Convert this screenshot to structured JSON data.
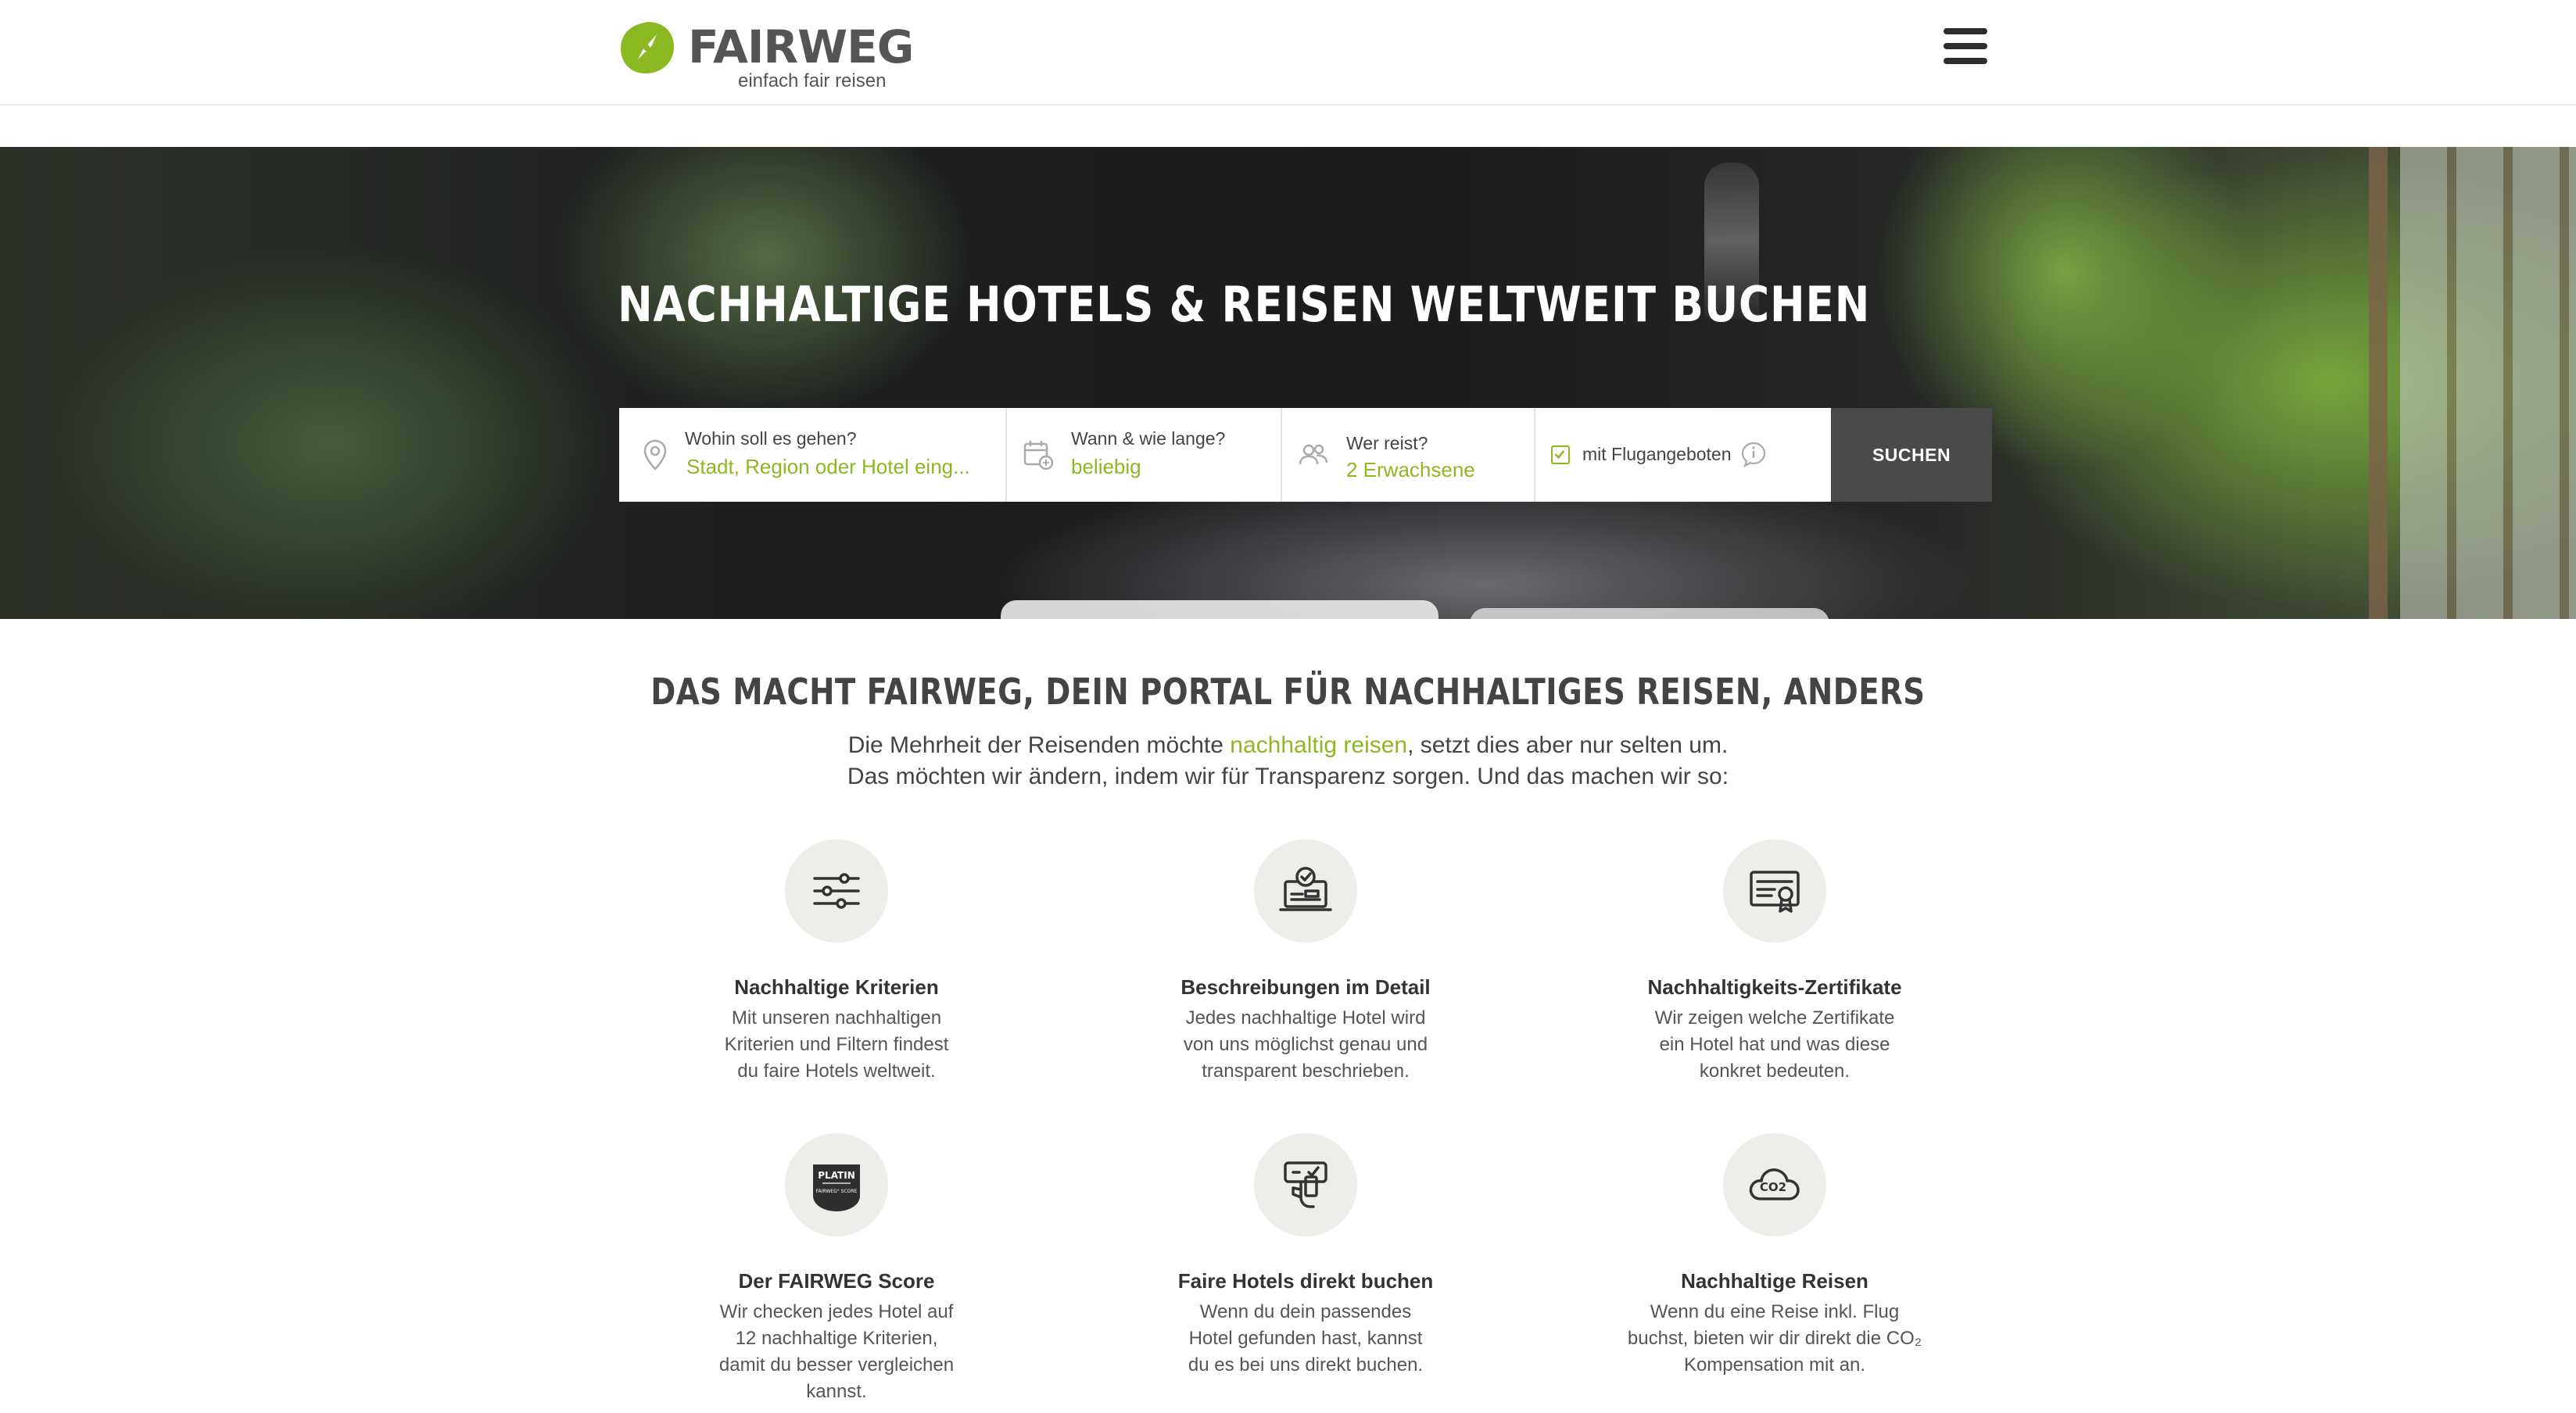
{
  "header": {
    "logo_name": "FAIRWEG",
    "logo_tagline": "einfach fair reisen",
    "menu_icon": "hamburger-menu-icon"
  },
  "hero": {
    "title": "NACHHALTIGE HOTELS & REISEN WELTWEIT BUCHEN"
  },
  "search": {
    "destination": {
      "label": "Wohin soll es gehen?",
      "placeholder": "Stadt, Region oder Hotel eing...",
      "icon": "location-pin-icon"
    },
    "dates": {
      "label": "Wann & wie lange?",
      "value": "beliebig",
      "icon": "calendar-icon"
    },
    "travelers": {
      "label": "Wer reist?",
      "value": "2 Erwachsene",
      "icon": "people-icon"
    },
    "flight": {
      "label": "mit Flugangeboten",
      "checked": true,
      "icon": "info-icon"
    },
    "button": "SUCHEN"
  },
  "section": {
    "title": "DAS MACHT FAIRWEG, DEIN PORTAL FÜR NACHHALTIGES REISEN, ANDERS",
    "intro_pre": "Die Mehrheit der Reisenden möchte ",
    "intro_link": "nachhaltig reisen",
    "intro_post": ", setzt dies aber nur selten um.",
    "intro_line2": "Das möchten wir ändern, indem wir für Transparenz sorgen. Und das machen wir so:"
  },
  "features": [
    {
      "icon": "sliders-icon",
      "title": "Nachhaltige Kriterien",
      "text": "Mit unseren nachhaltigen Kriterien und Filtern findest du faire Hotels weltweit."
    },
    {
      "icon": "laptop-check-icon",
      "title": "Beschreibungen im Detail",
      "text": "Jedes nachhaltige Hotel wird von uns möglichst genau und transparent beschrieben."
    },
    {
      "icon": "certificate-icon",
      "title": "Nachhaltigkeits-Zertifikate",
      "text": "Wir zeigen welche Zertifikate ein Hotel hat und was diese konkret bedeuten."
    },
    {
      "icon": "score-badge-icon",
      "badge_top": "PLATIN",
      "badge_bottom": "FAIRWEG° SCORE",
      "title": "Der FAIRWEG Score",
      "text": "Wir checken jedes Hotel auf 12 nachhaltige Kriterien, damit du besser vergleichen kannst."
    },
    {
      "icon": "booking-hand-icon",
      "title": "Faire Hotels direkt buchen",
      "text": "Wenn du dein passendes Hotel gefunden hast, kannst du es bei uns direkt buchen."
    },
    {
      "icon": "co2-cloud-icon",
      "badge_top": "CO2",
      "title": "Nachhaltige Reisen",
      "text": "Wenn du eine Reise inkl. Flug buchst, bieten wir dir direkt die CO₂ Kompensation mit an."
    }
  ],
  "colors": {
    "accent": "#8cb821",
    "button": "#4a4a4a",
    "text": "#404040",
    "icon_bg": "#efede9"
  }
}
